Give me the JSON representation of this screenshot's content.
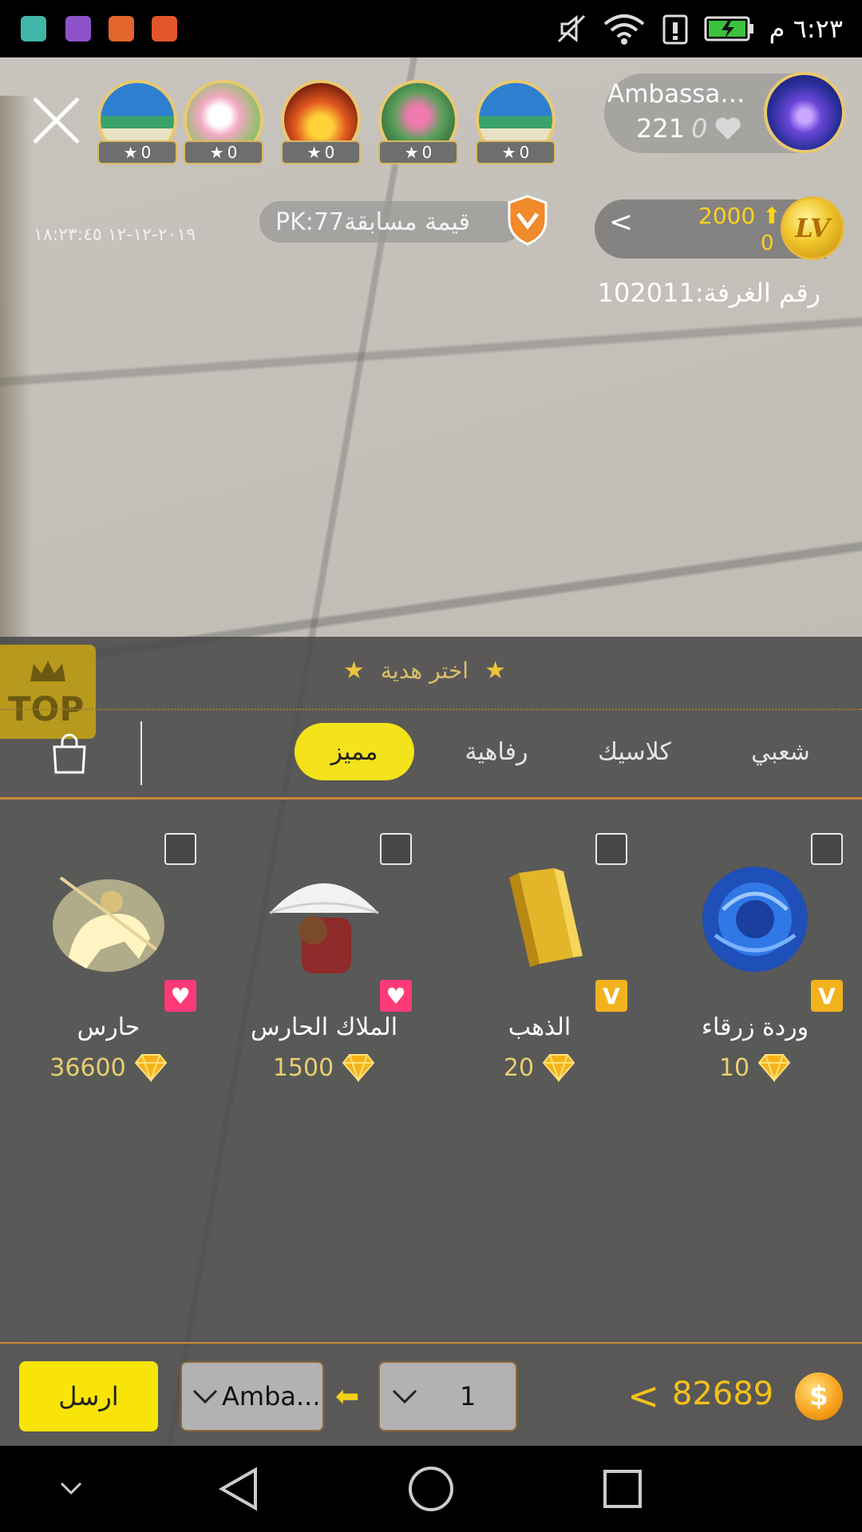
{
  "status_bar": {
    "time": "٦:٢٣ م",
    "app_icons": [
      "android-icon",
      "gallery-icon",
      "music-icon",
      "music-icon"
    ],
    "icons": [
      "mute-icon",
      "wifi-icon",
      "sim-icon",
      "battery-charging-icon"
    ]
  },
  "host": {
    "name": "Ambassad...",
    "count": "221",
    "likes": "0"
  },
  "viewers": [
    {
      "score": "0",
      "theme": "beach"
    },
    {
      "score": "0",
      "theme": "flowers"
    },
    {
      "score": "0",
      "theme": "fire-flowers"
    },
    {
      "score": "0",
      "theme": "lotus"
    },
    {
      "score": "0",
      "theme": "beach"
    }
  ],
  "pk": {
    "label": "قيمة مسابقةPK:77",
    "datetime": "٢٠١٩-١٢-١٢ ١٨:٢٣:٤٥"
  },
  "level": {
    "up_value": "2000",
    "sub_value": "0",
    "badge": "LV"
  },
  "room": {
    "label": "رقم الغرفة:102011"
  },
  "gift_panel": {
    "top_badge": "TOP",
    "choose_label": "اختر هدية",
    "tabs": [
      {
        "label": "شعبي",
        "active": false
      },
      {
        "label": "كلاسيك",
        "active": false
      },
      {
        "label": "رفاهية",
        "active": false
      },
      {
        "label": "مميز",
        "active": true
      }
    ],
    "gifts": [
      {
        "name": "وردة زرقاء",
        "price": "10",
        "tag": "V",
        "image": "blue-rose-icon"
      },
      {
        "name": "الذهب",
        "price": "20",
        "tag": "V",
        "image": "gold-bar-icon"
      },
      {
        "name": "الملاك الحارس",
        "price": "1500",
        "tag": "heart",
        "image": "umbrella-angel-icon"
      },
      {
        "name": "حارس",
        "price": "36600",
        "tag": "heart",
        "image": "knight-horse-icon"
      }
    ]
  },
  "bottom_bar": {
    "send_label": "ارسل",
    "recipient": "Amba...",
    "quantity": "1",
    "balance": "82689"
  },
  "colors": {
    "accent_yellow": "#f4e21a",
    "gold_text": "#e7cf72",
    "panel_bg": "#484848",
    "divider_orange": "#c9893a"
  }
}
